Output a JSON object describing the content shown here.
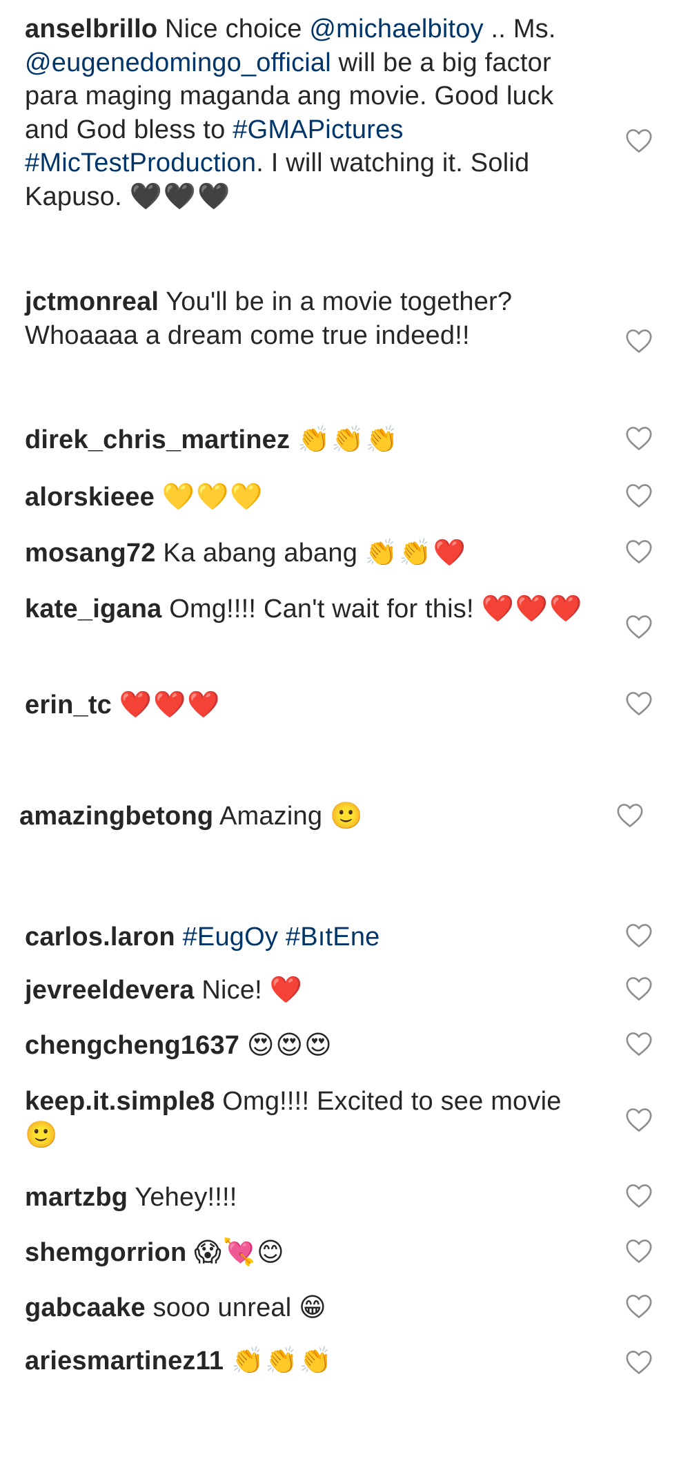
{
  "comments": [
    {
      "username": "anselbrillo",
      "text1": " Nice choice ",
      "tag1": "@michaelbitoy",
      "text2": " .. Ms. ",
      "tag2": "@eugenedomingo_official",
      "text3": " will be a big factor para maging maganda ang movie. Good luck and God bless to ",
      "tag3": "#GMAPictures",
      "text4": " ",
      "tag4": "#MicTestProduction",
      "text5": ". I will watching it. Solid Kapuso. ",
      "emoji": "🖤🖤🖤"
    },
    {
      "username": "jctmonreal",
      "text": " You'll be in a movie together? Whoaaaa a dream come true indeed!!",
      "emoji": ""
    },
    {
      "username": "direk_chris_martinez",
      "text": " ",
      "emoji": "👏👏👏"
    },
    {
      "username": "alorskieee",
      "text": " ",
      "emoji": "💛💛💛"
    },
    {
      "username": "mosang72",
      "text": " Ka abang abang ",
      "emoji": "👏👏❤️"
    },
    {
      "username": "kate_igana",
      "text": " Omg!!!! Can't wait for this! ",
      "emoji": "❤️❤️❤️"
    },
    {
      "username": "erin_tc",
      "text": " ",
      "emoji": "❤️❤️❤️"
    },
    {
      "username": "amazingbetong",
      "text": " Amazing ",
      "emoji": "🙂"
    },
    {
      "username": "carlos.laron",
      "text": " ",
      "tag1": "#EugOy",
      "text2": " ",
      "tag2": "#BıtEne",
      "emoji": ""
    },
    {
      "username": "jevreeldevera",
      "text": " Nice! ",
      "emoji": "❤️"
    },
    {
      "username": "chengcheng1637",
      "text": " ",
      "emoji": "😍😍😍"
    },
    {
      "username": "keep.it.simple8",
      "text": " Omg!!!! Excited to see movie ",
      "emoji": "🙂"
    },
    {
      "username": "martzbg",
      "text": " Yehey!!!!",
      "emoji": ""
    },
    {
      "username": "shemgorrion",
      "text": " ",
      "emoji": "😱💘😊"
    },
    {
      "username": "gabcaake",
      "text": " sooo unreal ",
      "emoji": "😁"
    },
    {
      "username": "ariesmartinez11",
      "text": " ",
      "emoji": "👏👏👏"
    }
  ],
  "icons": {
    "like": "heart-outline-icon"
  },
  "colors": {
    "text": "#262626",
    "tag": "#003569",
    "heart_stroke": "#8e8e8e"
  }
}
